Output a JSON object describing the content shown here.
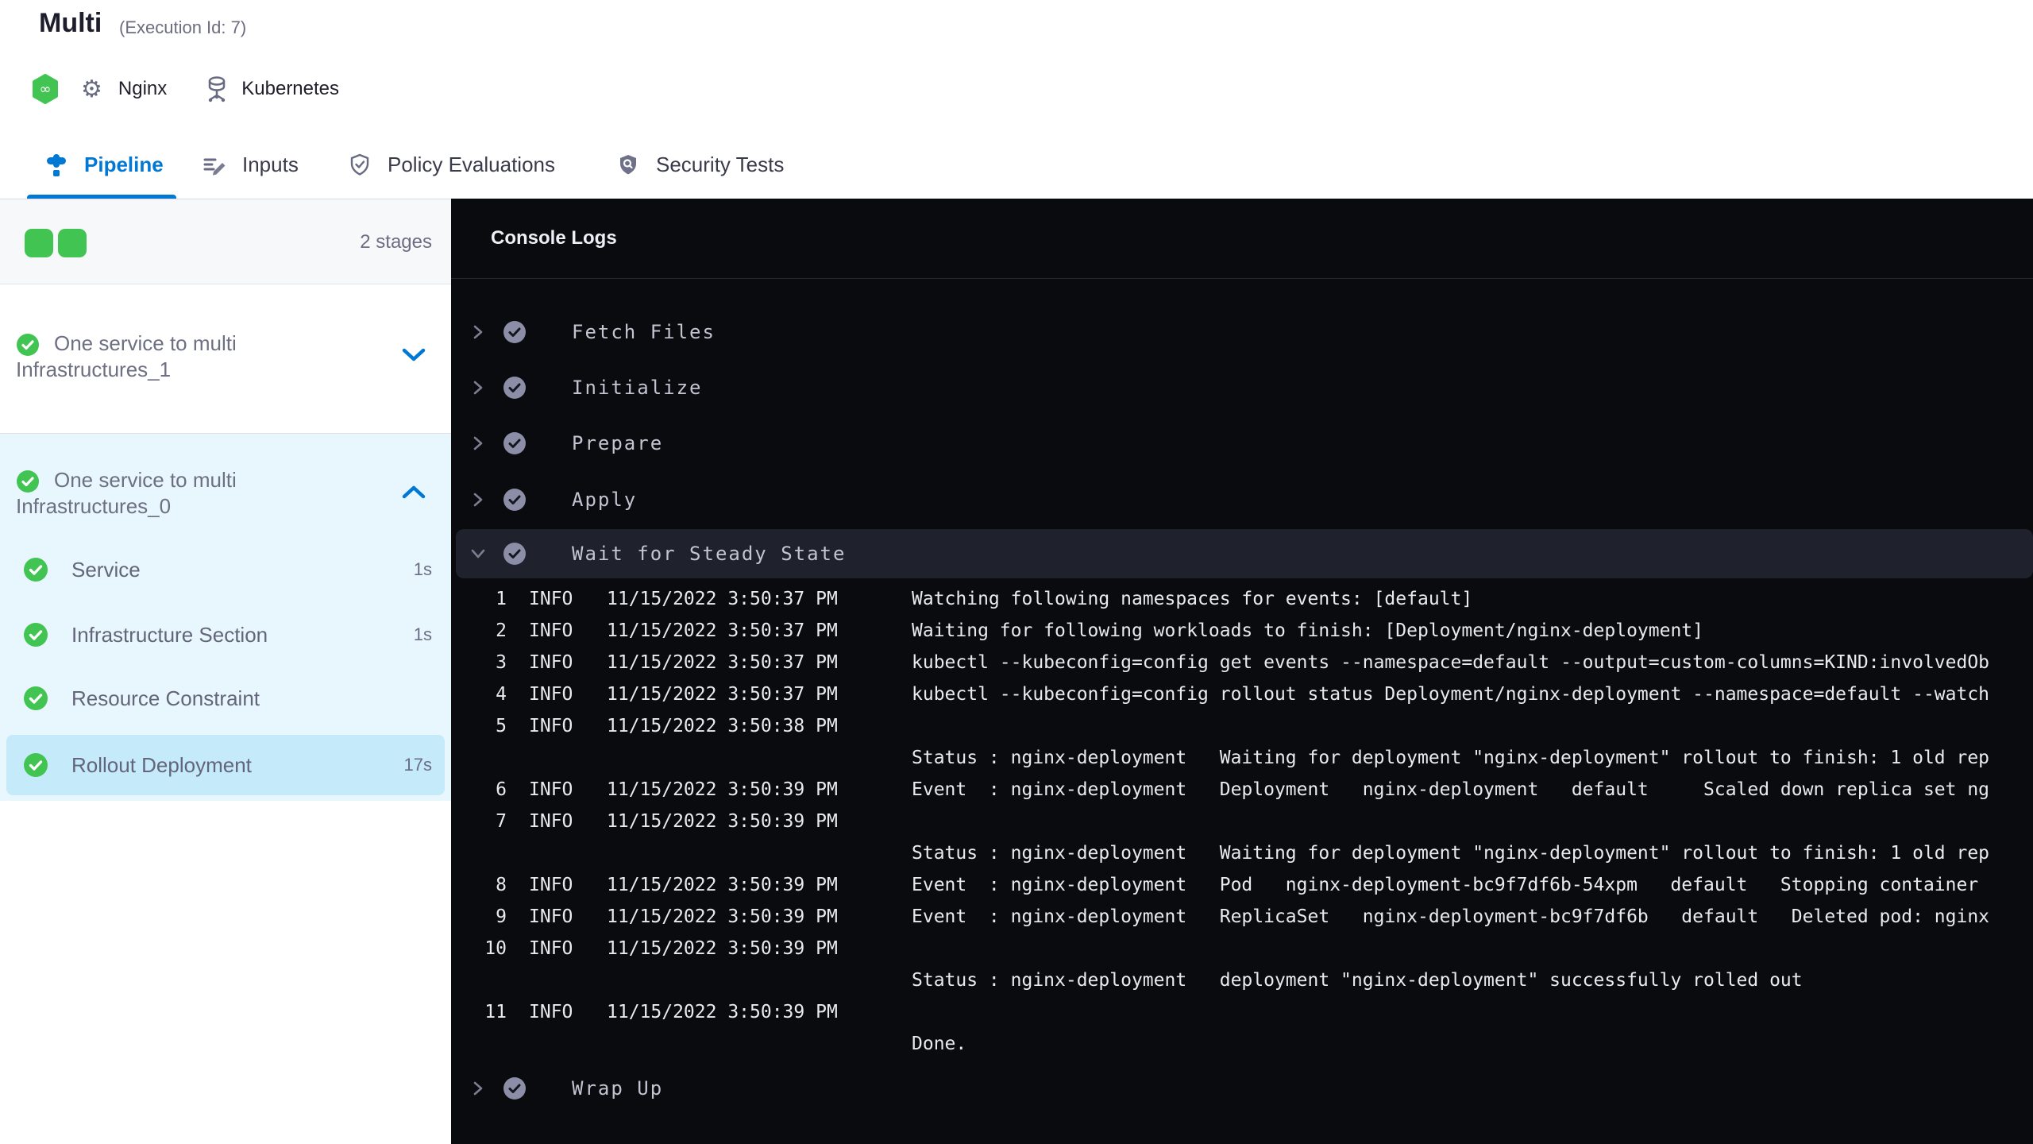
{
  "colors": {
    "accent_blue": "#0278d5",
    "success_green": "#42c452",
    "console_bg": "#0a0b0e",
    "expanded_stage_bg": "#e8f6fd",
    "selected_step_bg": "#c5ebfa"
  },
  "header": {
    "title": "Multi",
    "execution_id": "(Execution Id: 7)",
    "module_icon": "cd-module-icon",
    "service_icon": "gear-icon",
    "service_name": "Nginx",
    "environment_icon": "kubernetes-icon",
    "environment_name": "Kubernetes"
  },
  "tabs": [
    {
      "label": "Pipeline",
      "icon": "pipeline-icon",
      "active": true
    },
    {
      "label": "Inputs",
      "icon": "inputs-icon",
      "active": false
    },
    {
      "label": "Policy Evaluations",
      "icon": "policy-evaluations-icon",
      "active": false
    },
    {
      "label": "Security Tests",
      "icon": "security-tests-icon",
      "active": false
    }
  ],
  "sidebar": {
    "stages_count": "2 stages",
    "stage_squares": 2,
    "stages": [
      {
        "name_line1": "One service to multi",
        "name_line2": "Infrastructures_1",
        "status": "success",
        "expanded": false
      },
      {
        "name_line1": "One service to multi",
        "name_line2": "Infrastructures_0",
        "status": "success",
        "expanded": true,
        "steps": [
          {
            "name": "Service",
            "duration": "1s",
            "selected": false
          },
          {
            "name": "Infrastructure Section",
            "duration": "1s",
            "selected": false
          },
          {
            "name": "Resource Constraint",
            "duration": "",
            "selected": false
          },
          {
            "name": "Rollout Deployment",
            "duration": "17s",
            "selected": true
          }
        ]
      }
    ]
  },
  "console": {
    "title": "Console Logs",
    "steps": [
      {
        "name": "Fetch Files",
        "expanded": false
      },
      {
        "name": "Initialize",
        "expanded": false
      },
      {
        "name": "Prepare",
        "expanded": false
      },
      {
        "name": "Apply",
        "expanded": false
      },
      {
        "name": "Wait for Steady State",
        "expanded": true
      },
      {
        "name": "Wrap Up",
        "expanded": false
      }
    ],
    "logs": [
      {
        "num": "1",
        "level": "INFO",
        "time": "11/15/2022 3:50:37 PM",
        "msg": "Watching following namespaces for events: [default]"
      },
      {
        "num": "2",
        "level": "INFO",
        "time": "11/15/2022 3:50:37 PM",
        "msg": "Waiting for following workloads to finish: [Deployment/nginx-deployment]"
      },
      {
        "num": "3",
        "level": "INFO",
        "time": "11/15/2022 3:50:37 PM",
        "msg": "kubectl --kubeconfig=config get events --namespace=default --output=custom-columns=KIND:involvedOb"
      },
      {
        "num": "4",
        "level": "INFO",
        "time": "11/15/2022 3:50:37 PM",
        "msg": "kubectl --kubeconfig=config rollout status Deployment/nginx-deployment --namespace=default --watch"
      },
      {
        "num": "5",
        "level": "INFO",
        "time": "11/15/2022 3:50:38 PM",
        "msg": ""
      },
      {
        "num": "",
        "level": "",
        "time": "",
        "msg": "Status : nginx-deployment   Waiting for deployment \"nginx-deployment\" rollout to finish: 1 old rep"
      },
      {
        "num": "6",
        "level": "INFO",
        "time": "11/15/2022 3:50:39 PM",
        "msg": "Event  : nginx-deployment   Deployment   nginx-deployment   default     Scaled down replica set ng"
      },
      {
        "num": "7",
        "level": "INFO",
        "time": "11/15/2022 3:50:39 PM",
        "msg": ""
      },
      {
        "num": "",
        "level": "",
        "time": "",
        "msg": "Status : nginx-deployment   Waiting for deployment \"nginx-deployment\" rollout to finish: 1 old rep"
      },
      {
        "num": "8",
        "level": "INFO",
        "time": "11/15/2022 3:50:39 PM",
        "msg": "Event  : nginx-deployment   Pod   nginx-deployment-bc9f7df6b-54xpm   default   Stopping container"
      },
      {
        "num": "9",
        "level": "INFO",
        "time": "11/15/2022 3:50:39 PM",
        "msg": "Event  : nginx-deployment   ReplicaSet   nginx-deployment-bc9f7df6b   default   Deleted pod: nginx"
      },
      {
        "num": "10",
        "level": "INFO",
        "time": "11/15/2022 3:50:39 PM",
        "msg": ""
      },
      {
        "num": "",
        "level": "",
        "time": "",
        "msg": "Status : nginx-deployment   deployment \"nginx-deployment\" successfully rolled out"
      },
      {
        "num": "11",
        "level": "INFO",
        "time": "11/15/2022 3:50:39 PM",
        "msg": ""
      },
      {
        "num": "",
        "level": "",
        "time": "",
        "msg": "Done."
      }
    ]
  }
}
